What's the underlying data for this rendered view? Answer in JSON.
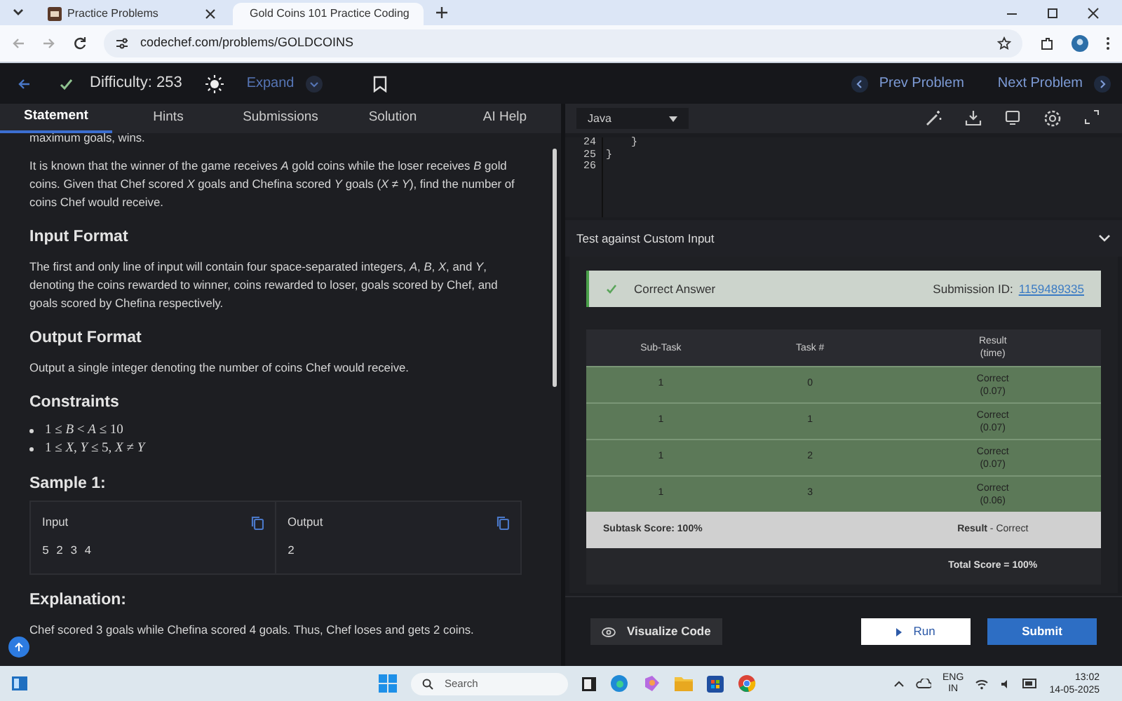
{
  "browser": {
    "tabs": [
      {
        "title": "Practice Problems",
        "selected": false
      },
      {
        "title": "Gold Coins 101 Practice Coding",
        "selected": true
      }
    ],
    "url": "codechef.com/problems/GOLDCOINS"
  },
  "header": {
    "solved": true,
    "difficulty": "Difficulty: 253",
    "expand": "Expand",
    "prev": "Prev Problem",
    "next": "Next Problem"
  },
  "problem_tabs": [
    {
      "label": "Statement",
      "selected": true
    },
    {
      "label": "Hints",
      "selected": false
    },
    {
      "label": "Submissions",
      "selected": false
    },
    {
      "label": "Solution",
      "selected": false
    },
    {
      "label": "AI Help",
      "selected": false
    }
  ],
  "statement": [
    {
      "kind": "paragraph",
      "text": "maximum goals, wins."
    },
    {
      "kind": "paragraph",
      "text": "It is known that the winner of the game receives *A* gold coins while the loser receives *B* gold coins. Given that Chef scored *X* goals and Chefina scored *Y* goals (*X* ≠ *Y*), find the number of coins Chef would receive."
    },
    {
      "kind": "heading",
      "text": "Input Format"
    },
    {
      "kind": "paragraph",
      "text": "The first and only line of input will contain four space-separated integers, *A*, *B*, *X*, and *Y*, denoting the coins rewarded to winner, coins rewarded to loser, goals scored by Chef, and goals scored by Chefina respectively."
    },
    {
      "kind": "heading",
      "text": "Output Format"
    },
    {
      "kind": "paragraph",
      "text": "Output a single integer denoting the number of coins Chef would receive."
    },
    {
      "kind": "heading",
      "text": "Constraints"
    },
    {
      "kind": "list",
      "items": [
        "1 ≤ *B* < *A* ≤ 10",
        "1 ≤ *X*, *Y* ≤ 5,  *X* ≠ *Y*"
      ]
    },
    {
      "kind": "heading",
      "text": "Sample 1:"
    },
    {
      "kind": "sample",
      "input_label": "Input",
      "input": "5 2 3 4",
      "output_label": "Output",
      "output": "2"
    },
    {
      "kind": "heading",
      "text": "Explanation:"
    },
    {
      "kind": "paragraph",
      "text": "Chef scored 3 goals while Chefina scored 4 goals. Thus, Chef loses and gets 2 coins."
    }
  ],
  "editor": {
    "language": "Java",
    "lines": [
      {
        "number": "24",
        "code": "    }"
      },
      {
        "number": "25",
        "code": "}"
      },
      {
        "number": "26"
      }
    ]
  },
  "custom_input": {
    "title": "Test against Custom Input",
    "expanded": false
  },
  "result": {
    "verdict": "Correct Answer",
    "submission_label": "Submission ID:",
    "submission_id": "1159489335",
    "columns": [
      "Sub-Task",
      "Task #",
      "Result\n(time)"
    ],
    "rows": [
      {
        "subtask": "1",
        "task": "0",
        "result": "Correct",
        "time": "(0.07)"
      },
      {
        "subtask": "1",
        "task": "1",
        "result": "Correct",
        "time": "(0.07)"
      },
      {
        "subtask": "1",
        "task": "2",
        "result": "Correct",
        "time": "(0.07)"
      },
      {
        "subtask": "1",
        "task": "3",
        "result": "Correct",
        "time": "(0.06)"
      }
    ],
    "subtask_score": "Subtask Score: 100%",
    "result_label": "Result",
    "result_value": "- Correct",
    "total": "Total Score = 100%"
  },
  "buttons": {
    "visualize": "Visualize Code",
    "run": "Run",
    "submit": "Submit"
  },
  "taskbar": {
    "search": "Search",
    "lang": "ENG",
    "region": "IN",
    "time": "13:02",
    "date": "14-05-2025"
  }
}
